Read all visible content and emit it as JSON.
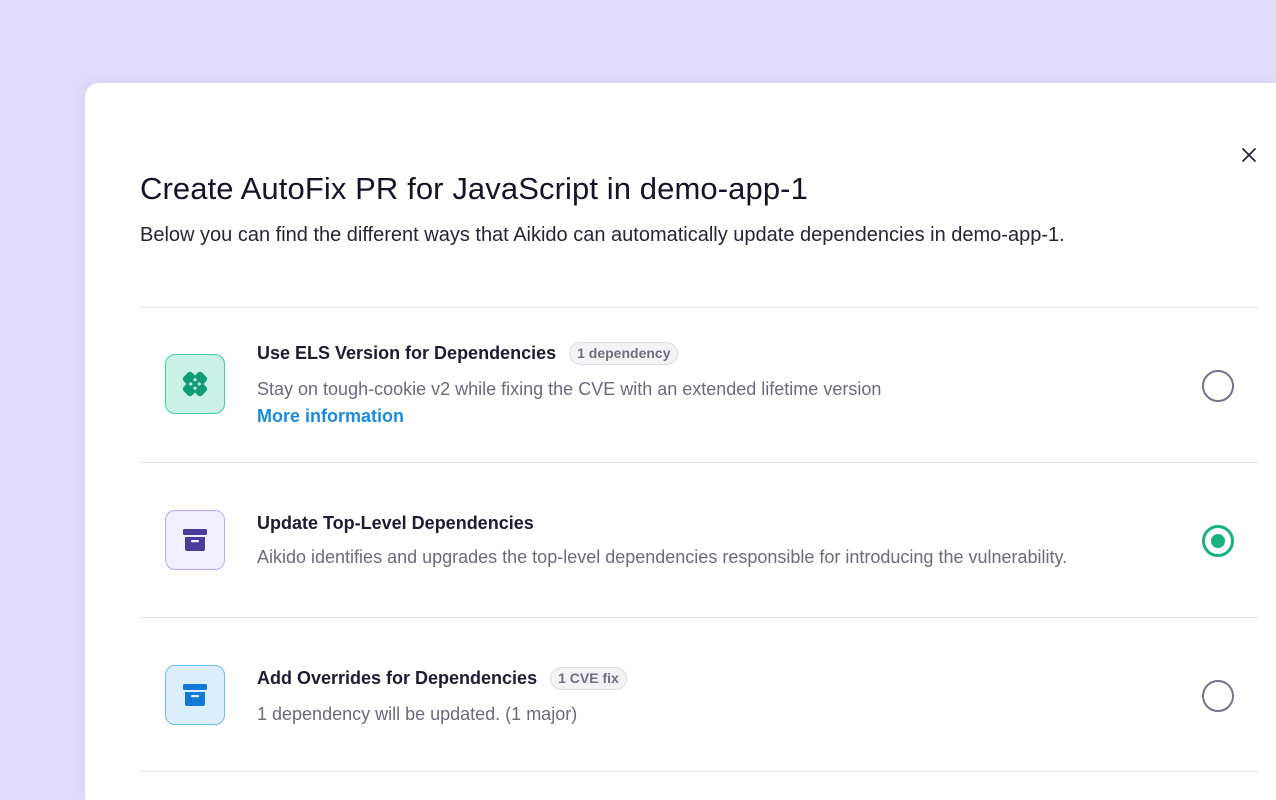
{
  "modal": {
    "title": "Create AutoFix PR for JavaScript in demo-app-1",
    "subtitle": "Below you can find the different ways that Aikido can automatically update dependencies in demo-app-1.",
    "close_icon": "close-icon"
  },
  "options": [
    {
      "title": "Use ELS Version for Dependencies",
      "badge": "1 dependency",
      "description": "Stay on tough-cookie v2 while fixing the CVE with an extended lifetime version",
      "link": "More information",
      "icon": "bandage-icon",
      "icon_color": "#0e9d74",
      "selected": false
    },
    {
      "title": "Update Top-Level Dependencies",
      "description": "Aikido identifies and upgrades the top-level dependencies responsible for introducing the vulnerability.",
      "icon": "archive-box-icon",
      "icon_color": "#4a3b9c",
      "selected": true
    },
    {
      "title": "Add Overrides for Dependencies",
      "badge": "1 CVE fix",
      "description": "1 dependency will be updated. (1 major)",
      "icon": "archive-box-icon",
      "icon_color": "#1279d6",
      "selected": false
    }
  ],
  "colors": {
    "background": "#e1dcfc",
    "selected_radio": "#17b27f",
    "link": "#1a8ce0"
  }
}
